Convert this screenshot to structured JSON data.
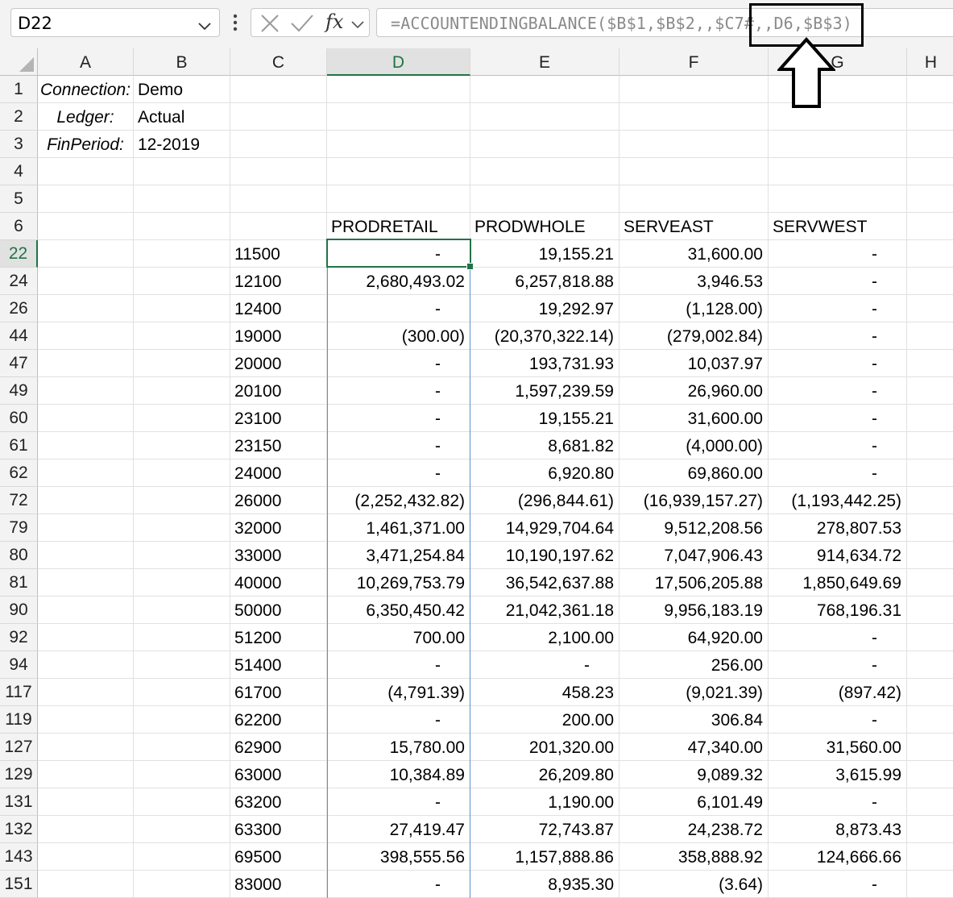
{
  "name_box": {
    "value": "D22"
  },
  "formula_bar": {
    "fx": "fx",
    "formula": "=ACCOUNTENDINGBALANCE($B$1,$B$2,,$C7#,,D6,$B$3)"
  },
  "columns": [
    "A",
    "B",
    "C",
    "D",
    "E",
    "F",
    "G",
    "H"
  ],
  "selected_column": "D",
  "selected_row": "22",
  "header_rows": [
    {
      "row": "1",
      "a": "Connection:",
      "b": "Demo"
    },
    {
      "row": "2",
      "a": "Ledger:",
      "b": "Actual"
    },
    {
      "row": "3",
      "a": "FinPeriod:",
      "b": "12-2019"
    },
    {
      "row": "4",
      "a": "",
      "b": ""
    },
    {
      "row": "5",
      "a": "",
      "b": ""
    }
  ],
  "row6": {
    "row": "6",
    "d": "PRODRETAIL",
    "e": "PRODWHOLE",
    "f": "SERVEAST",
    "g": "SERVWEST"
  },
  "data_rows": [
    {
      "row": "22",
      "c": "11500",
      "d": "-",
      "e": "19,155.21",
      "f": "31,600.00",
      "g": "-"
    },
    {
      "row": "24",
      "c": "12100",
      "d": "2,680,493.02",
      "e": "6,257,818.88",
      "f": "3,946.53",
      "g": "-"
    },
    {
      "row": "26",
      "c": "12400",
      "d": "-",
      "e": "19,292.97",
      "f": "(1,128.00)",
      "g": "-"
    },
    {
      "row": "44",
      "c": "19000",
      "d": "(300.00)",
      "e": "(20,370,322.14)",
      "f": "(279,002.84)",
      "g": "-"
    },
    {
      "row": "47",
      "c": "20000",
      "d": "-",
      "e": "193,731.93",
      "f": "10,037.97",
      "g": "-"
    },
    {
      "row": "49",
      "c": "20100",
      "d": "-",
      "e": "1,597,239.59",
      "f": "26,960.00",
      "g": "-"
    },
    {
      "row": "60",
      "c": "23100",
      "d": "-",
      "e": "19,155.21",
      "f": "31,600.00",
      "g": "-"
    },
    {
      "row": "61",
      "c": "23150",
      "d": "-",
      "e": "8,681.82",
      "f": "(4,000.00)",
      "g": "-"
    },
    {
      "row": "62",
      "c": "24000",
      "d": "-",
      "e": "6,920.80",
      "f": "69,860.00",
      "g": "-"
    },
    {
      "row": "72",
      "c": "26000",
      "d": "(2,252,432.82)",
      "e": "(296,844.61)",
      "f": "(16,939,157.27)",
      "g": "(1,193,442.25)"
    },
    {
      "row": "79",
      "c": "32000",
      "d": "1,461,371.00",
      "e": "14,929,704.64",
      "f": "9,512,208.56",
      "g": "278,807.53"
    },
    {
      "row": "80",
      "c": "33000",
      "d": "3,471,254.84",
      "e": "10,190,197.62",
      "f": "7,047,906.43",
      "g": "914,634.72"
    },
    {
      "row": "81",
      "c": "40000",
      "d": "10,269,753.79",
      "e": "36,542,637.88",
      "f": "17,506,205.88",
      "g": "1,850,649.69"
    },
    {
      "row": "90",
      "c": "50000",
      "d": "6,350,450.42",
      "e": "21,042,361.18",
      "f": "9,956,183.19",
      "g": "768,196.31"
    },
    {
      "row": "92",
      "c": "51200",
      "d": "700.00",
      "e": "2,100.00",
      "f": "64,920.00",
      "g": "-"
    },
    {
      "row": "94",
      "c": "51400",
      "d": "-",
      "e": "-",
      "f": "256.00",
      "g": "-"
    },
    {
      "row": "117",
      "c": "61700",
      "d": "(4,791.39)",
      "e": "458.23",
      "f": "(9,021.39)",
      "g": "(897.42)"
    },
    {
      "row": "119",
      "c": "62200",
      "d": "-",
      "e": "200.00",
      "f": "306.84",
      "g": "-"
    },
    {
      "row": "127",
      "c": "62900",
      "d": "15,780.00",
      "e": "201,320.00",
      "f": "47,340.00",
      "g": "31,560.00"
    },
    {
      "row": "129",
      "c": "63000",
      "d": "10,384.89",
      "e": "26,209.80",
      "f": "9,089.32",
      "g": "3,615.99"
    },
    {
      "row": "131",
      "c": "63200",
      "d": "-",
      "e": "1,190.00",
      "f": "6,101.49",
      "g": "-"
    },
    {
      "row": "132",
      "c": "63300",
      "d": "27,419.47",
      "e": "72,743.87",
      "f": "24,238.72",
      "g": "8,873.43"
    },
    {
      "row": "143",
      "c": "69500",
      "d": "398,555.56",
      "e": "1,157,888.86",
      "f": "358,888.92",
      "g": "124,666.66"
    },
    {
      "row": "151",
      "c": "83000",
      "d": "-",
      "e": "8,935.30",
      "f": "(3.64)",
      "g": "-"
    }
  ],
  "icons": {
    "name_box_dropdown": "chevron-down-icon",
    "more": "vertical-dots-icon",
    "cancel": "x-icon",
    "enter": "check-icon",
    "function": "fx-icon",
    "fx_dropdown": "chevron-down-icon",
    "annotation": "up-arrow-icon"
  },
  "colors": {
    "selection_green": "#217346",
    "column_outline_blue": "#5b8fc9"
  }
}
